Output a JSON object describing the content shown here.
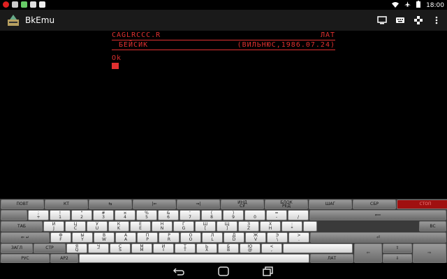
{
  "status": {
    "time": "18:00"
  },
  "app": {
    "title": "BkEmu"
  },
  "terminal": {
    "line1_left": "CAGLRCCC.R",
    "line1_right": "ЛАТ",
    "line2_left": "БЕЙСИК",
    "line2_right": "(ВИЛЬНЮС,1986.07.24)",
    "prompt": "Ok"
  },
  "keyboard": {
    "row1": [
      {
        "l": "ПОВТ"
      },
      {
        "l": "КТ"
      },
      {
        "l": "⇆"
      },
      {
        "l": "|⇐"
      },
      {
        "l": "⇒|"
      },
      {
        "t": "ИНД",
        "b": "СУ"
      },
      {
        "t": "БЛОК",
        "b": "РЕД"
      },
      {
        "l": "ШАГ"
      },
      {
        "l": "СБР"
      },
      {
        "l": "СТОП"
      }
    ],
    "row2": [
      {
        "t": ";",
        "b": "+"
      },
      {
        "t": "!",
        "b": "1"
      },
      {
        "t": "\"",
        "b": "2"
      },
      {
        "t": "#",
        "b": "3"
      },
      {
        "t": "¤",
        "b": "4"
      },
      {
        "t": "%",
        "b": "5"
      },
      {
        "t": "&",
        "b": "6"
      },
      {
        "t": "'",
        "b": "7"
      },
      {
        "t": "(",
        "b": "8"
      },
      {
        "t": ")",
        "b": "9"
      },
      {
        "t": "",
        "b": "0"
      },
      {
        "t": "=",
        "b": "-"
      },
      {
        "t": "",
        "b": "/"
      }
    ],
    "row3": [
      {
        "t": "Й",
        "b": "J"
      },
      {
        "t": "Ц",
        "b": "C"
      },
      {
        "t": "У",
        "b": "U"
      },
      {
        "t": "К",
        "b": "K"
      },
      {
        "t": "Е",
        "b": "E"
      },
      {
        "t": "Н",
        "b": "N"
      },
      {
        "t": "Г",
        "b": "G"
      },
      {
        "t": "Ш",
        "b": "["
      },
      {
        "t": "Щ",
        "b": "]"
      },
      {
        "t": "З",
        "b": "Z"
      },
      {
        "t": "Х",
        "b": "H"
      },
      {
        "t": ":",
        "b": "*"
      }
    ],
    "row4": [
      {
        "t": "Ф",
        "b": "F"
      },
      {
        "t": "Ы",
        "b": "Y"
      },
      {
        "t": "В",
        "b": "W"
      },
      {
        "t": "А",
        "b": "A"
      },
      {
        "t": "П",
        "b": "P"
      },
      {
        "t": "Р",
        "b": "R"
      },
      {
        "t": "О",
        "b": "O"
      },
      {
        "t": "Л",
        "b": "L"
      },
      {
        "t": "Д",
        "b": "D"
      },
      {
        "t": "Ж",
        "b": "V"
      },
      {
        "t": "Э",
        "b": "\\"
      },
      {
        "t": ">",
        "b": "."
      }
    ],
    "row5": [
      {
        "t": "Я",
        "b": "Q"
      },
      {
        "t": "Ч",
        "b": "^"
      },
      {
        "t": "С",
        "b": "S"
      },
      {
        "t": "М",
        "b": "M"
      },
      {
        "t": "И",
        "b": "I"
      },
      {
        "t": "Т",
        "b": "T"
      },
      {
        "t": "Ь",
        "b": "X"
      },
      {
        "t": "Б",
        "b": "B"
      },
      {
        "t": "Ю",
        "b": "@"
      },
      {
        "t": "<",
        "b": ","
      }
    ],
    "tab": "ТАБ",
    "vs": "ВС",
    "zagl": "ЗАГЛ",
    "str": "СТР",
    "rus": "РУС",
    "ar2": "АР2",
    "lat": "ЛАТ"
  }
}
